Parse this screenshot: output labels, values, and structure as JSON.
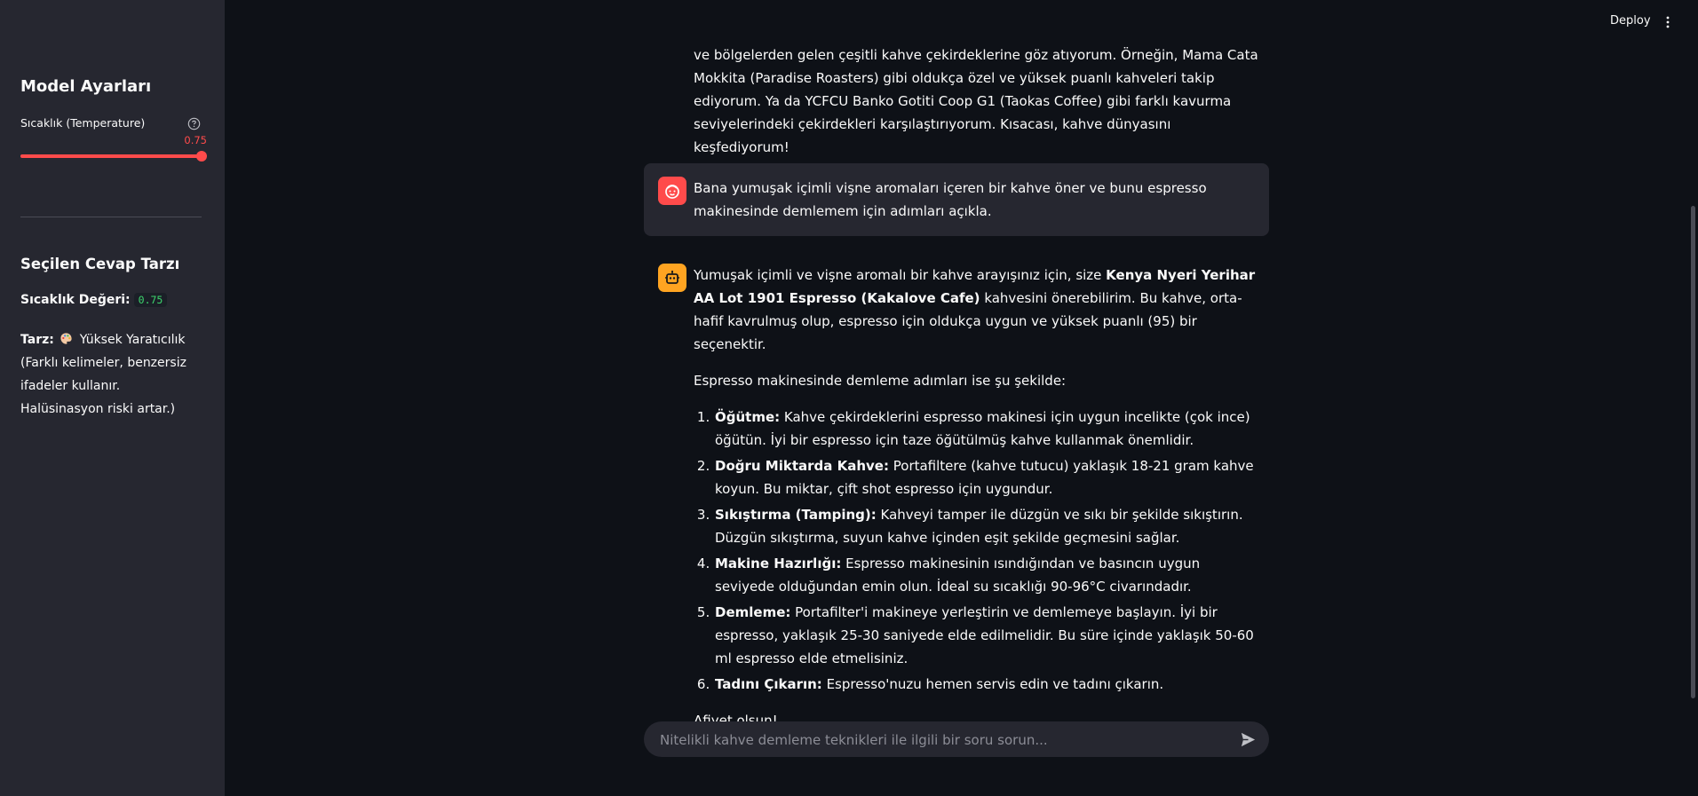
{
  "sidebar": {
    "title": "Model Ayarları",
    "slider": {
      "label": "Sıcaklık (Temperature)",
      "value": "0.75",
      "min": 0,
      "max": 0.75,
      "fraction": 1.0,
      "help_icon": "question-circle-icon"
    },
    "selected_style_title": "Seçilen Cevap Tarzı",
    "temp_value_label": "Sıcaklık Değeri:",
    "temp_value": "0.75",
    "style_label": "Tarz:",
    "style_icon": "palette-icon",
    "style_text": "Yüksek Yaratıcılık (Farklı kelimeler, benzersiz ifadeler kullanır. Halüsinasyon riski artar.)"
  },
  "header": {
    "deploy_label": "Deploy",
    "menu_icon": "kebab-menu-icon"
  },
  "colors": {
    "accent": "#ff4b4b",
    "bot_avatar": "#ffa421",
    "bg": "#0e1117",
    "sidebar_bg": "#262730",
    "code_green": "#3dd56d"
  },
  "chat": {
    "prev_assistant_tail": "ve bölgelerden gelen çeşitli kahve çekirdeklerine göz atıyorum. Örneğin, Mama Cata Mokkita (Paradise Roasters) gibi oldukça özel ve yüksek puanlı kahveleri takip ediyorum. Ya da YCFCU Banko Gotiti Coop G1 (Taokas Coffee) gibi farklı kavurma seviyelerindeki çekirdekleri karşılaştırıyorum. Kısacası, kahve dünyasını keşfediyorum!",
    "user_message": "Bana yumuşak içimli vişne aromaları içeren bir kahve öner ve bunu espresso makinesinde demlemem için adımları açıkla.",
    "assistant": {
      "intro_pre": "Yumuşak içimli ve vişne aromalı bir kahve arayışınız için, size ",
      "intro_bold": "Kenya Nyeri Yerihar AA Lot 1901 Espresso (Kakalove Cafe)",
      "intro_post": " kahvesini önerebilirim. Bu kahve, orta-hafif kavrulmuş olup, espresso için oldukça uygun ve yüksek puanlı (95) bir seçenektir.",
      "steps_intro": "Espresso makinesinde demleme adımları ise şu şekilde:",
      "steps": [
        {
          "title": "Öğütme:",
          "text": " Kahve çekirdeklerini espresso makinesi için uygun incelikte (çok ince) öğütün. İyi bir espresso için taze öğütülmüş kahve kullanmak önemlidir."
        },
        {
          "title": "Doğru Miktarda Kahve:",
          "text": " Portafiltere (kahve tutucu) yaklaşık 18-21 gram kahve koyun. Bu miktar, çift shot espresso için uygundur."
        },
        {
          "title": "Sıkıştırma (Tamping):",
          "text": " Kahveyi tamper ile düzgün ve sıkı bir şekilde sıkıştırın. Düzgün sıkıştırma, suyun kahve içinden eşit şekilde geçmesini sağlar."
        },
        {
          "title": "Makine Hazırlığı:",
          "text": " Espresso makinesinin ısındığından ve basıncın uygun seviyede olduğundan emin olun. İdeal su sıcaklığı 90-96°C civarındadır."
        },
        {
          "title": "Demleme:",
          "text": " Portafilter'i makineye yerleştirin ve demlemeye başlayın. İyi bir espresso, yaklaşık 25-30 saniyede elde edilmelidir. Bu süre içinde yaklaşık 50-60 ml espresso elde etmelisiniz."
        },
        {
          "title": "Tadını Çıkarın:",
          "text": " Espresso'nuzu hemen servis edin ve tadını çıkarın."
        }
      ],
      "closing": "Afiyet olsun!"
    }
  },
  "input": {
    "placeholder": "Nitelikli kahve demleme teknikleri ile ilgili bir soru sorun...",
    "value": "",
    "send_icon": "send-icon"
  }
}
